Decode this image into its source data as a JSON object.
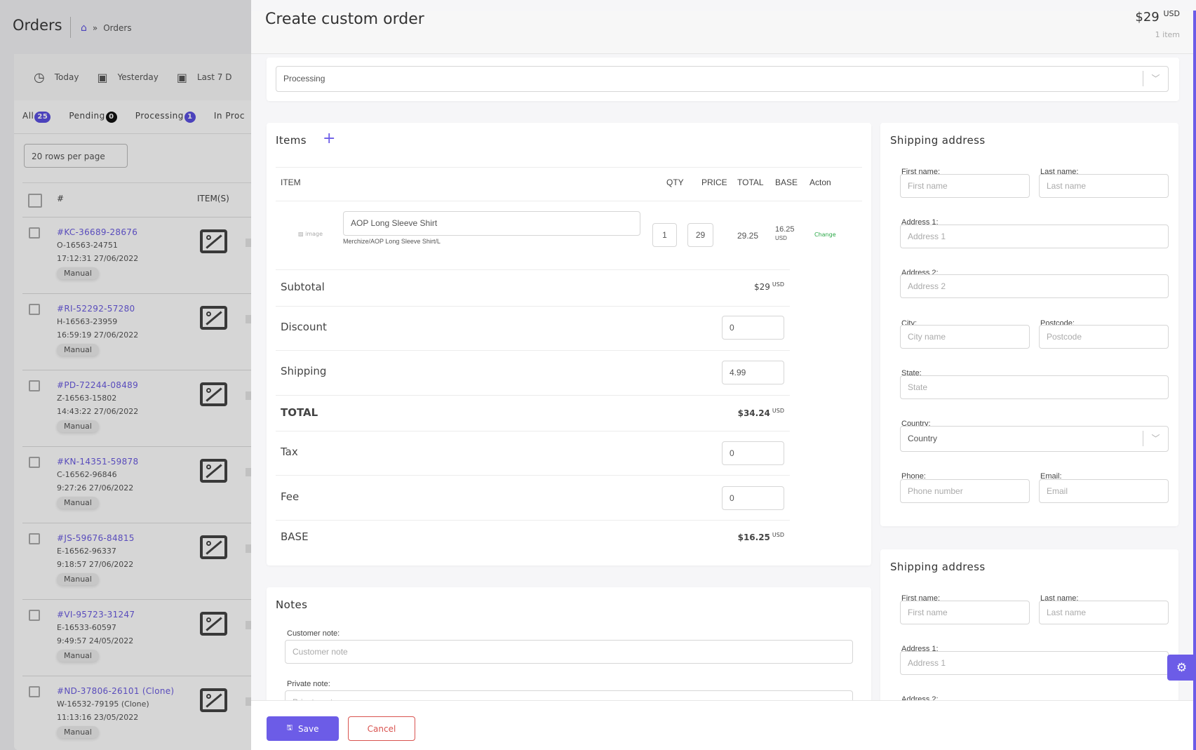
{
  "background": {
    "title": "Orders",
    "breadcrumb": {
      "separator": "»",
      "current": "Orders"
    },
    "date_filters": [
      "Today",
      "Yesterday",
      "Last 7 D"
    ],
    "tabs": [
      {
        "label": "All",
        "count": "25"
      },
      {
        "label": "Pending",
        "count": "0"
      },
      {
        "label": "Processing",
        "count": "1"
      },
      {
        "label": "In Proc",
        "count": ""
      }
    ],
    "rows_per_page": "20 rows per page",
    "columns": [
      "#",
      "ITEM(S)"
    ],
    "orders": [
      {
        "id": "#KC-36689-28676",
        "ref": "O-16563-24751",
        "time": "17:12:31 27/06/2022",
        "tag": "Manual"
      },
      {
        "id": "#RI-52292-57280",
        "ref": "H-16563-23959",
        "time": "16:59:19 27/06/2022",
        "tag": "Manual"
      },
      {
        "id": "#PD-72244-08489",
        "ref": "Z-16563-15802",
        "time": "14:43:22 27/06/2022",
        "tag": "Manual"
      },
      {
        "id": "#KN-14351-59878",
        "ref": "C-16562-96846",
        "time": "9:27:26 27/06/2022",
        "tag": "Manual"
      },
      {
        "id": "#JS-59676-84815",
        "ref": "E-16562-96337",
        "time": "9:18:57 27/06/2022",
        "tag": "Manual"
      },
      {
        "id": "#VI-95723-31247",
        "ref": "E-16533-60597",
        "time": "9:49:57 24/05/2022",
        "tag": "Manual"
      },
      {
        "id": "#ND-37806-26101 (Clone)",
        "ref": "W-16532-79195 (Clone)",
        "time": "11:13:16 23/05/2022",
        "tag": "Manual"
      }
    ]
  },
  "drawer": {
    "title": "Create custom order",
    "price": "$29",
    "currency": "USD",
    "item_count": "1 item",
    "status": "Processing",
    "items": {
      "title": "Items",
      "columns": [
        "ITEM",
        "QTY",
        "PRICE",
        "TOTAL",
        "BASE",
        "Acton"
      ],
      "rows": [
        {
          "image_label": "image",
          "name": "AOP Long Sleeve Shirt",
          "sku": "Merchize/AOP Long Sleeve Shirt/L",
          "qty": "1",
          "price": "29",
          "total": "29.25",
          "base": "16.25",
          "base_currency": "USD",
          "action": "Change"
        }
      ],
      "summary": {
        "subtotal": {
          "label": "Subtotal",
          "value": "$29",
          "currency": "USD"
        },
        "discount": {
          "label": "Discount",
          "value": "0"
        },
        "shipping": {
          "label": "Shipping",
          "value": "4.99"
        },
        "total": {
          "label": "TOTAL",
          "value": "$34.24",
          "currency": "USD"
        },
        "tax": {
          "label": "Tax",
          "value": "0"
        },
        "fee": {
          "label": "Fee",
          "value": "0"
        },
        "base": {
          "label": "BASE",
          "value": "$16.25",
          "currency": "USD"
        }
      }
    },
    "notes": {
      "title": "Notes",
      "customer_label": "Customer note:",
      "customer_placeholder": "Customer note",
      "private_label": "Private note:",
      "private_placeholder": "Private note"
    },
    "shipping": {
      "title": "Shipping address",
      "first_name_label": "First name:",
      "first_name_placeholder": "First name",
      "last_name_label": "Last name:",
      "last_name_placeholder": "Last name",
      "address1_label": "Address 1:",
      "address1_placeholder": "Address 1",
      "address2_label": "Address 2:",
      "address2_placeholder": "Address 2",
      "city_label": "City:",
      "city_placeholder": "City name",
      "postcode_label": "Postcode:",
      "postcode_placeholder": "Postcode",
      "state_label": "State:",
      "state_placeholder": "State",
      "country_label": "Country:",
      "country_value": "Country",
      "phone_label": "Phone:",
      "phone_placeholder": "Phone number",
      "email_label": "Email:",
      "email_placeholder": "Email"
    },
    "footer": {
      "save": "Save",
      "cancel": "Cancel"
    }
  },
  "colors": {
    "accent": "#6c5ce7",
    "danger": "#d9534f",
    "success": "#28a745"
  }
}
